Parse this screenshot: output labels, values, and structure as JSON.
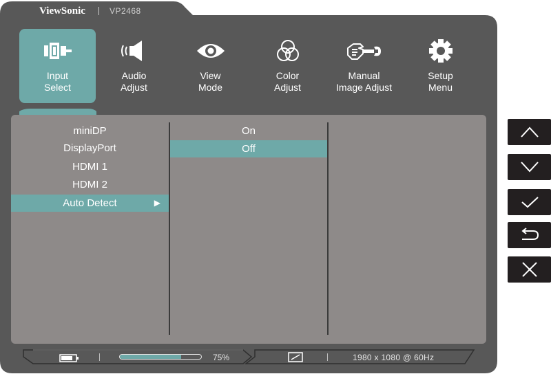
{
  "brand": {
    "name": "ViewSonic",
    "model": "VP2468"
  },
  "tabs": [
    {
      "line1": "Input",
      "line2": "Select",
      "icon": "input-plug-icon",
      "active": true
    },
    {
      "line1": "Audio",
      "line2": "Adjust",
      "icon": "speaker-icon",
      "active": false
    },
    {
      "line1": "View",
      "line2": "Mode",
      "icon": "eye-icon",
      "active": false
    },
    {
      "line1": "Color",
      "line2": "Adjust",
      "icon": "color-circles-icon",
      "active": false
    },
    {
      "line1": "Manual",
      "line2": "Image Adjust",
      "icon": "hand-wrench-icon",
      "active": false
    },
    {
      "line1": "Setup",
      "line2": "Menu",
      "icon": "gear-icon",
      "active": false
    }
  ],
  "input_sources": [
    {
      "label": "miniDP",
      "selected": false
    },
    {
      "label": "DisplayPort",
      "selected": false
    },
    {
      "label": "HDMI 1",
      "selected": false
    },
    {
      "label": "HDMI 2",
      "selected": false
    },
    {
      "label": "Auto Detect",
      "selected": true,
      "has_submenu": true
    }
  ],
  "submenu_arrow": "▶",
  "auto_detect_options": [
    {
      "label": "On",
      "selected": false
    },
    {
      "label": "Off",
      "selected": true
    }
  ],
  "status_bar": {
    "progress_percent": 75,
    "progress_text": "75%",
    "resolution": "1980 x 1080 @ 60Hz"
  },
  "nav_buttons": [
    {
      "name": "up-button",
      "icon": "chevron-up-icon"
    },
    {
      "name": "down-button",
      "icon": "chevron-down-icon"
    },
    {
      "name": "confirm-button",
      "icon": "check-icon"
    },
    {
      "name": "back-button",
      "icon": "return-icon"
    },
    {
      "name": "exit-button",
      "icon": "close-icon"
    }
  ],
  "colors": {
    "frame": "#585858",
    "panel": "#8e8a89",
    "accent": "#6ea9a8",
    "button": "#231f20"
  }
}
